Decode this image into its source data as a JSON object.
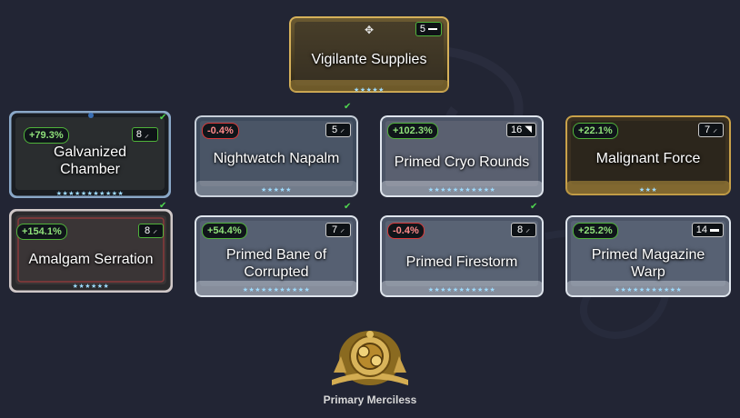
{
  "title": "Primary Merciless",
  "aura": {
    "name": "Vigilante Supplies",
    "drain": "5",
    "rank": "★★★★★"
  },
  "mods": [
    {
      "name": "Galvanized\nChamber",
      "stat": "+79.3%",
      "stat_type": "pos",
      "drain": "8",
      "rank": "★★★★★★★★★★★",
      "flag": true
    },
    {
      "name": "Nightwatch Napalm",
      "stat": "-0.4%",
      "stat_type": "neg",
      "drain": "5",
      "rank": "★★★★★",
      "flag": true
    },
    {
      "name": "Primed Cryo Rounds",
      "stat": "+102.3%",
      "stat_type": "pos",
      "drain": "16",
      "rank": "★★★★★★★★★★★",
      "flag": false
    },
    {
      "name": "Malignant Force",
      "stat": "+22.1%",
      "stat_type": "pos",
      "drain": "7",
      "rank": "★★★",
      "flag": false
    },
    {
      "name": "Amalgam Serration",
      "stat": "+154.1%",
      "stat_type": "pos",
      "drain": "8",
      "rank": "★★★★★★",
      "flag": true
    },
    {
      "name": "Primed Bane of\nCorrupted",
      "stat": "+54.4%",
      "stat_type": "pos",
      "drain": "7",
      "rank": "★★★★★★★★★★★",
      "flag": true
    },
    {
      "name": "Primed Firestorm",
      "stat": "-0.4%",
      "stat_type": "neg",
      "drain": "8",
      "rank": "★★★★★★★★★★★",
      "flag": true
    },
    {
      "name": "Primed Magazine\nWarp",
      "stat": "+25.2%",
      "stat_type": "pos",
      "drain": "14",
      "rank": "★★★★★★★★★★★",
      "flag": false
    }
  ],
  "colors": {
    "background": "#222534",
    "gold": "#c9a24a",
    "positive": "#8fe07a",
    "negative": "#ff8a8a"
  }
}
